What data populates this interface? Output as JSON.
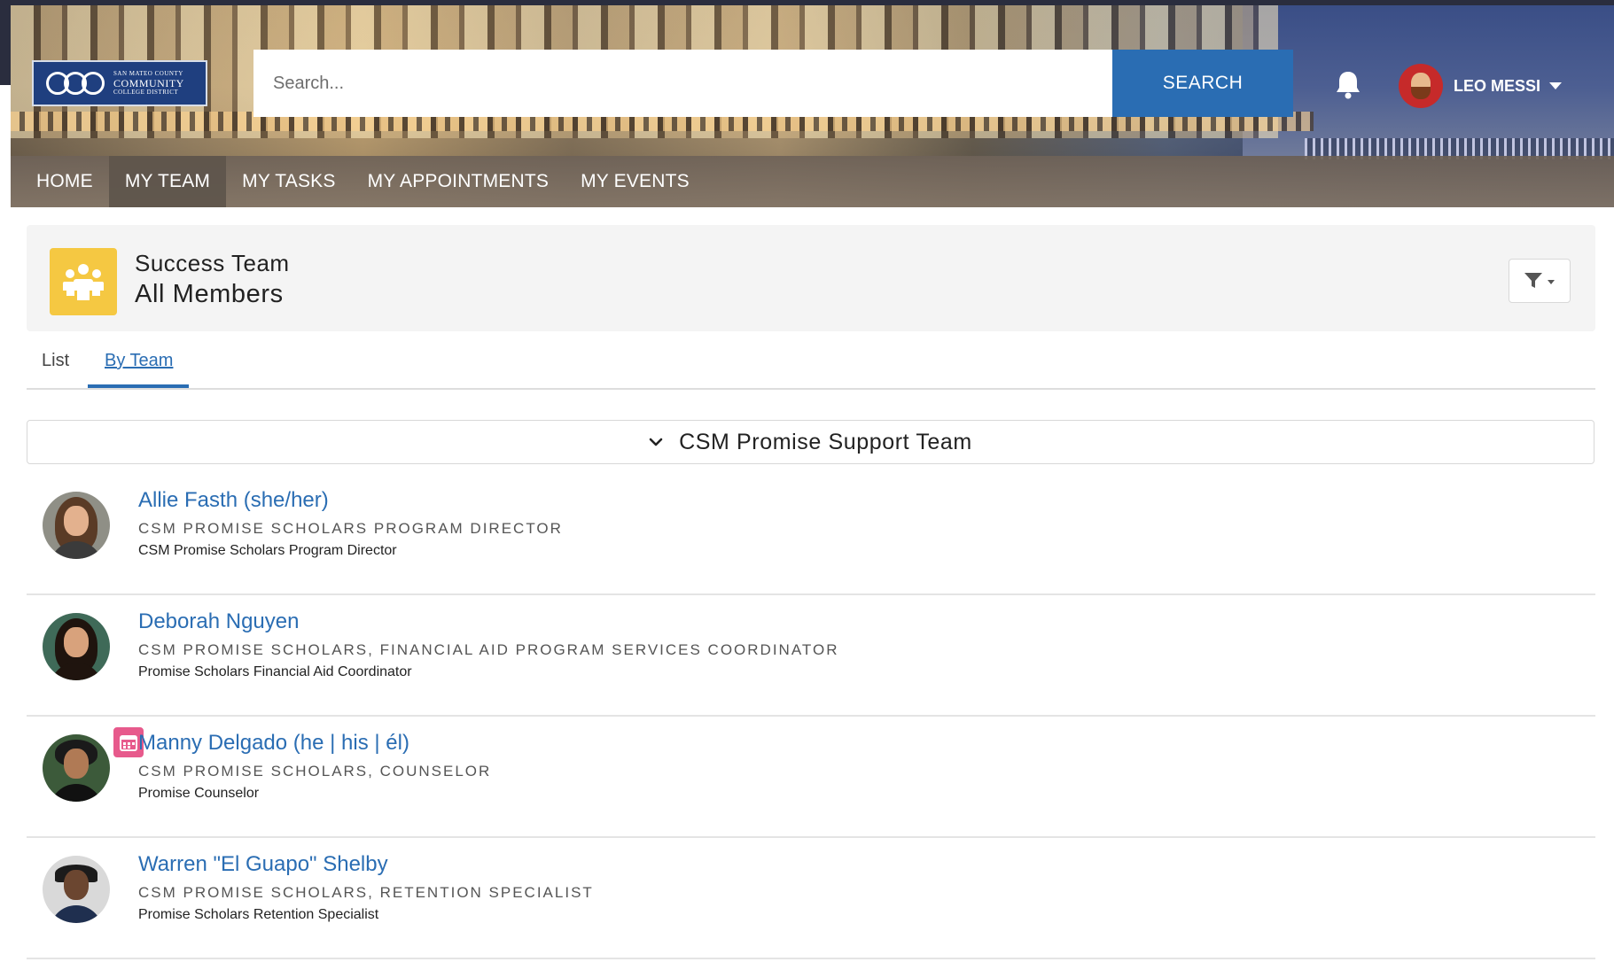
{
  "logo": {
    "line1": "SAN MATEO COUNTY",
    "line2": "COMMUNITY",
    "line3": "COLLEGE DISTRICT"
  },
  "search": {
    "placeholder": "Search...",
    "button_label": "SEARCH"
  },
  "user": {
    "name": "LEO MESSI"
  },
  "nav": {
    "items": [
      {
        "label": "HOME"
      },
      {
        "label": "MY TEAM"
      },
      {
        "label": "MY TASKS"
      },
      {
        "label": "MY APPOINTMENTS"
      },
      {
        "label": "MY EVENTS"
      }
    ]
  },
  "header": {
    "title_line1": "Success Team",
    "title_line2": "All Members"
  },
  "tabs": [
    {
      "label": "List"
    },
    {
      "label": "By Team"
    }
  ],
  "team": {
    "name": "CSM Promise Support Team"
  },
  "members": [
    {
      "name": "Allie Fasth (she/her)",
      "role": "CSM PROMISE SCHOLARS PROGRAM DIRECTOR",
      "subtitle": "CSM Promise Scholars Program Director"
    },
    {
      "name": "Deborah Nguyen",
      "role": "CSM PROMISE SCHOLARS, FINANCIAL AID PROGRAM SERVICES COORDINATOR",
      "subtitle": "Promise Scholars Financial Aid Coordinator"
    },
    {
      "name": "Manny Delgado (he | his | él)",
      "role": "CSM PROMISE SCHOLARS, COUNSELOR",
      "subtitle": "Promise Counselor"
    },
    {
      "name": "Warren \"El Guapo\" Shelby",
      "role": "CSM PROMISE SCHOLARS, RETENTION SPECIALIST",
      "subtitle": "Promise Scholars Retention Specialist"
    }
  ],
  "colors": {
    "accent": "#2a6db3",
    "team_icon": "#f5c842",
    "calendar_badge": "#e75a8c"
  },
  "icons": {
    "bell": "bell-icon",
    "team": "team-group-icon",
    "filter": "filter-icon",
    "accordion": "chevron-down-icon",
    "calendar": "calendar-icon"
  }
}
